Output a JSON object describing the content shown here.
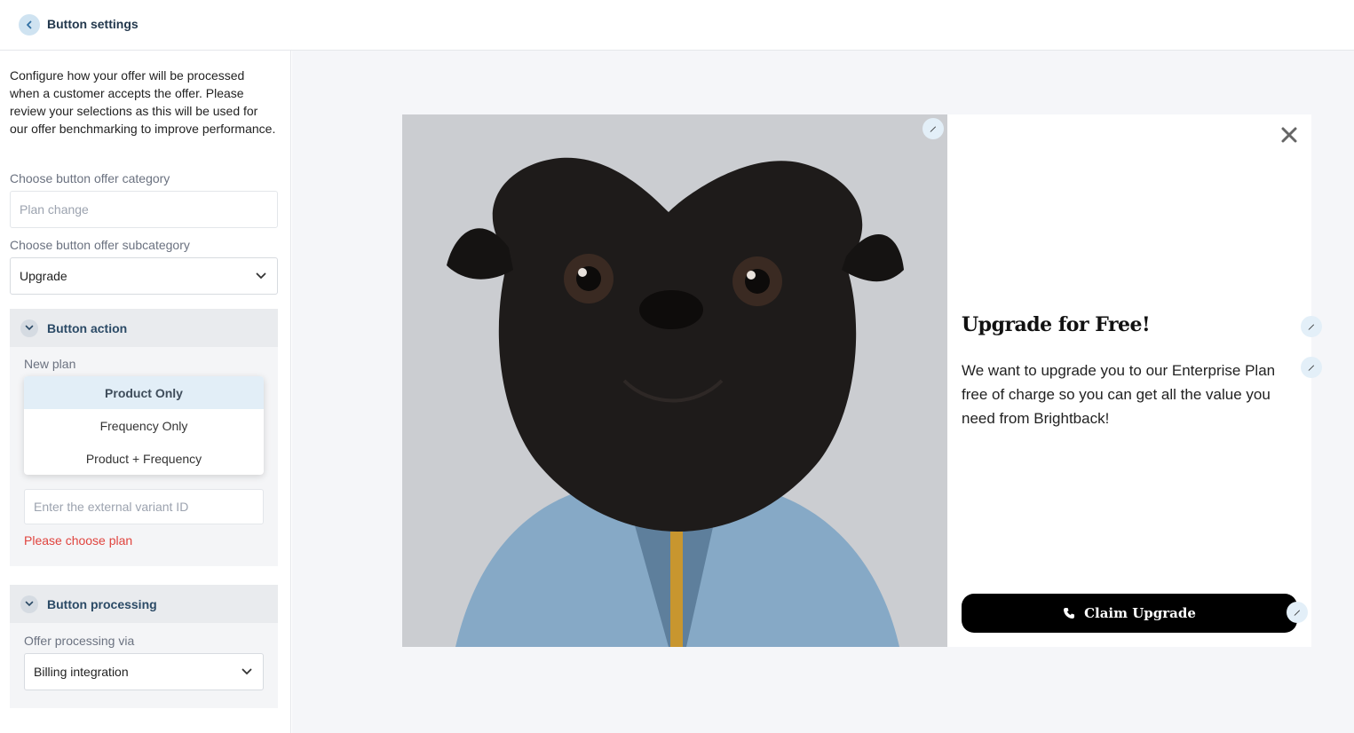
{
  "header": {
    "title": "Button settings",
    "back_icon": "chevron-left-icon"
  },
  "sidebar": {
    "intro": "Configure how your offer will be processed when a customer accepts the offer. Please review your selections as this will be used for our offer benchmarking to improve performance.",
    "category": {
      "label": "Choose button offer category",
      "placeholder": "Plan change"
    },
    "subcategory": {
      "label": "Choose button offer subcategory",
      "value": "Upgrade"
    },
    "button_action": {
      "title": "Button action",
      "new_plan_label": "New plan",
      "options": [
        "Product Only",
        "Frequency Only",
        "Product + Frequency"
      ],
      "selected_option": "Product Only",
      "variant_placeholder": "Enter the external variant ID",
      "error": "Please choose plan"
    },
    "button_processing": {
      "title": "Button processing",
      "label": "Offer processing via",
      "value": "Billing integration"
    }
  },
  "preview": {
    "heading": "Upgrade for Free!",
    "body": "We want to upgrade you to our Enterprise Plan free of charge so you can get all the value you need from Brightback!",
    "cta_label": "Claim Upgrade",
    "cta_icon": "phone-icon",
    "close_icon": "close-icon",
    "edit_icon": "pencil-icon"
  },
  "colors": {
    "accent": "#2b4a66",
    "error": "#e0443e",
    "cta_bg": "#000000"
  }
}
